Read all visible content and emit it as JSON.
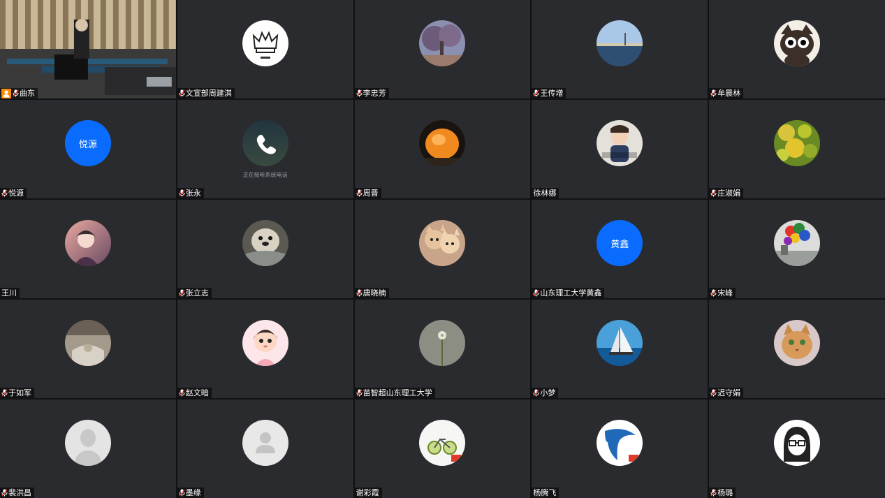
{
  "participants": [
    {
      "name": "曲东",
      "type": "video",
      "host": true
    },
    {
      "name": "文宣部周建淇",
      "type": "image",
      "icon": "crown-logo-icon"
    },
    {
      "name": "李忠芳",
      "type": "image",
      "icon": "tree-photo-icon"
    },
    {
      "name": "王传增",
      "type": "image",
      "icon": "lake-photo-icon"
    },
    {
      "name": "牟晨林",
      "type": "image",
      "icon": "cat-cartoon-icon"
    },
    {
      "name": "悦源",
      "type": "text",
      "avatar_text": "悦源"
    },
    {
      "name": "张永",
      "type": "phone",
      "status_text": "正在接听系统电话"
    },
    {
      "name": "周晋",
      "type": "image",
      "icon": "orange-lamp-icon"
    },
    {
      "name": "徐林娜",
      "type": "image",
      "icon": "baby-photo-icon",
      "no_mic": true
    },
    {
      "name": "庄淑娟",
      "type": "image",
      "icon": "leaves-photo-icon"
    },
    {
      "name": "王川",
      "type": "image",
      "icon": "boy-illustration-icon",
      "no_mic": true
    },
    {
      "name": "张立志",
      "type": "image",
      "icon": "otter-photo-icon"
    },
    {
      "name": "唐晓楠",
      "type": "image",
      "icon": "kittens-photo-icon"
    },
    {
      "name": "山东理工大学黄鑫",
      "type": "text",
      "avatar_text": "黄鑫"
    },
    {
      "name": "宋峰",
      "type": "image",
      "icon": "balloons-photo-icon"
    },
    {
      "name": "于如军",
      "type": "image",
      "icon": "blurred-photo-icon"
    },
    {
      "name": "赵文暗",
      "type": "image",
      "icon": "girl-cartoon-icon"
    },
    {
      "name": "苗智超山东理工大学",
      "type": "image",
      "icon": "dandelion-photo-icon"
    },
    {
      "name": "小梦",
      "type": "image",
      "icon": "sailboat-photo-icon"
    },
    {
      "name": "迟守娟",
      "type": "image",
      "icon": "cat-painting-icon"
    },
    {
      "name": "裴洪昌",
      "type": "image",
      "icon": "default-person-icon"
    },
    {
      "name": "墨缘",
      "type": "image",
      "icon": "default-user-icon"
    },
    {
      "name": "谢彩霞",
      "type": "image",
      "icon": "bicycle-photo-icon",
      "no_mic": true
    },
    {
      "name": "杨腾飞",
      "type": "image",
      "icon": "dolphin-logo-icon",
      "no_mic": true
    },
    {
      "name": "杨璐",
      "type": "image",
      "icon": "glasses-girl-icon"
    }
  ],
  "colors": {
    "tile_bg": "#2a2b2f",
    "text_avatar_bg": "#0a6cff",
    "host_badge": "#ff8a00"
  }
}
